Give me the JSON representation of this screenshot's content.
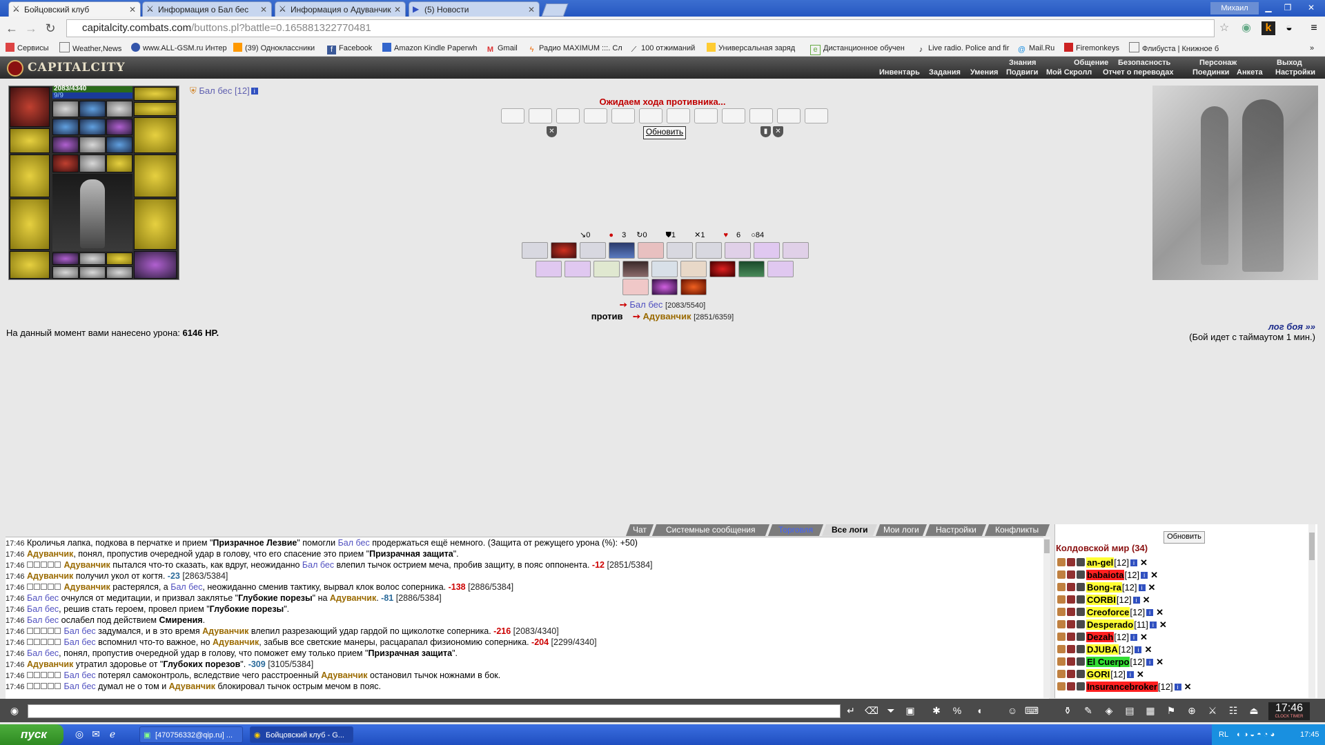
{
  "browser": {
    "tabs": [
      {
        "label": "Бойцовский клуб"
      },
      {
        "label": "Информация о Бал бес"
      },
      {
        "label": "Информация о Адуванчик"
      },
      {
        "label": "(5) Новости"
      }
    ],
    "user": "Михаил",
    "url_host": "capitalcity.combats.com",
    "url_path": "/buttons.pl?battle=0.165881322770481"
  },
  "bookmarks": [
    "Сервисы",
    "Weather,News",
    "www.ALL-GSM.ru Интер",
    "(39) Одноклассники",
    "Facebook",
    "Amazon Kindle Paperwh",
    "Gmail",
    "Радио MAXIMUM :::. Сл",
    "100 отжиманий",
    "Универсальная заряд",
    "Дистанционное обучен",
    "Live radio. Police and fir",
    "Mail.Ru",
    "Firemonkeys",
    "Флибуста | Книжное б"
  ],
  "game": {
    "logo": "CAPITALCITY",
    "menu_top": [
      "Знания",
      "Общение",
      "Безопасность",
      "Персонаж",
      "Выход"
    ],
    "menu_bottom": [
      "Инвентарь",
      "Задания",
      "Умения",
      "Подвиги",
      "Мой Скролл",
      "Отчет о переводах",
      "Поединки",
      "Анкета",
      "Настройки"
    ]
  },
  "fighter": {
    "name": "Бал бес",
    "level": "[12]",
    "hp": "2083/4340",
    "mana": "9/9"
  },
  "battle": {
    "waiting": "Ожидаем хода противника...",
    "refresh": "Обновить",
    "stats": [
      "0",
      "3",
      "0",
      "1",
      "1",
      "6",
      "84"
    ],
    "p1_name": "Бал бес",
    "p1_hp": "[2083/5540]",
    "vs": "против",
    "p2_name": "Адуванчик",
    "p2_hp": "[2851/6359]",
    "damage_label": "На данный момент вами нанесено урона:",
    "damage_value": "6146 HP.",
    "log_link": "лог боя »»",
    "timeout_text": "(Бой идет с таймаутом 1 мин.)"
  },
  "chat": {
    "tabs": [
      "Чат",
      "Системные сообщения",
      "Торговля",
      "Все логи",
      "Мои логи",
      "Настройки",
      "Конфликты"
    ]
  },
  "players": {
    "refresh": "Обновить",
    "title": "Колдовской мир (34)",
    "list": [
      {
        "name": "an-gel",
        "lvl": "[12]",
        "bg": "#ffff33"
      },
      {
        "name": "babaiota",
        "lvl": "[12]",
        "bg": "#ff2020"
      },
      {
        "name": "Bong-ra",
        "lvl": "[12]",
        "bg": "#ffff33"
      },
      {
        "name": "CORBI",
        "lvl": "[12]",
        "bg": "#ffff33"
      },
      {
        "name": "Creoforce",
        "lvl": "[12]",
        "bg": "#ffff33"
      },
      {
        "name": "Desperado",
        "lvl": "[11]",
        "bg": "#ffff33"
      },
      {
        "name": "Dezah",
        "lvl": "[12]",
        "bg": "#ff2020"
      },
      {
        "name": "DJUBA",
        "lvl": "[12]",
        "bg": "#ffff33"
      },
      {
        "name": "El Cuerpo",
        "lvl": "[12]",
        "bg": "#33dd33"
      },
      {
        "name": "GORI",
        "lvl": "[12]",
        "bg": "#ffff33"
      },
      {
        "name": "Insurancebroker",
        "lvl": "[12]",
        "bg": "#ff2020"
      }
    ]
  },
  "taskbar": {
    "start": "пуск",
    "tasks": [
      "[470756332@qip.ru] ...",
      "Бойцовский клуб - G..."
    ],
    "lang": "RL",
    "time": "17:45"
  },
  "clock": "17:46"
}
